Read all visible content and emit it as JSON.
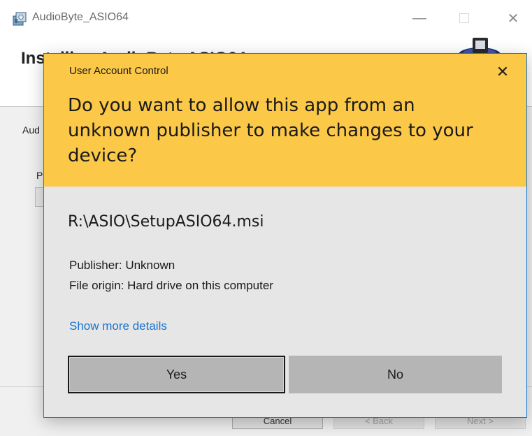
{
  "installer": {
    "window_title": "AudioByte_ASIO64",
    "heading": "Installing AudioByte ASIO64",
    "status_label": "Aud",
    "progress_label": "P",
    "cancel_label": "Cancel",
    "back_label": "< Back",
    "next_label": "Next >",
    "icons": {
      "app": "installer-package-icon",
      "logo": "cd-installer-logo-icon",
      "minimize": "minimize-icon",
      "maximize": "maximize-icon",
      "close": "close-icon"
    },
    "glyphs": {
      "minimize": "—",
      "close": "✕"
    }
  },
  "uac": {
    "title": "User Account Control",
    "close_glyph": "✕",
    "question": "Do you want to allow this app from an unknown publisher to make changes to your device?",
    "program": "R:\\ASIO\\SetupASIO64.msi",
    "publisher": "Publisher: Unknown",
    "file_origin": "File origin: Hard drive on this computer",
    "more_details": "Show more details",
    "yes_label": "Yes",
    "no_label": "No",
    "colors": {
      "header": "#fcc847",
      "body": "#e6e6e6",
      "link": "#1a73d0",
      "border": "#1f79c8"
    }
  }
}
